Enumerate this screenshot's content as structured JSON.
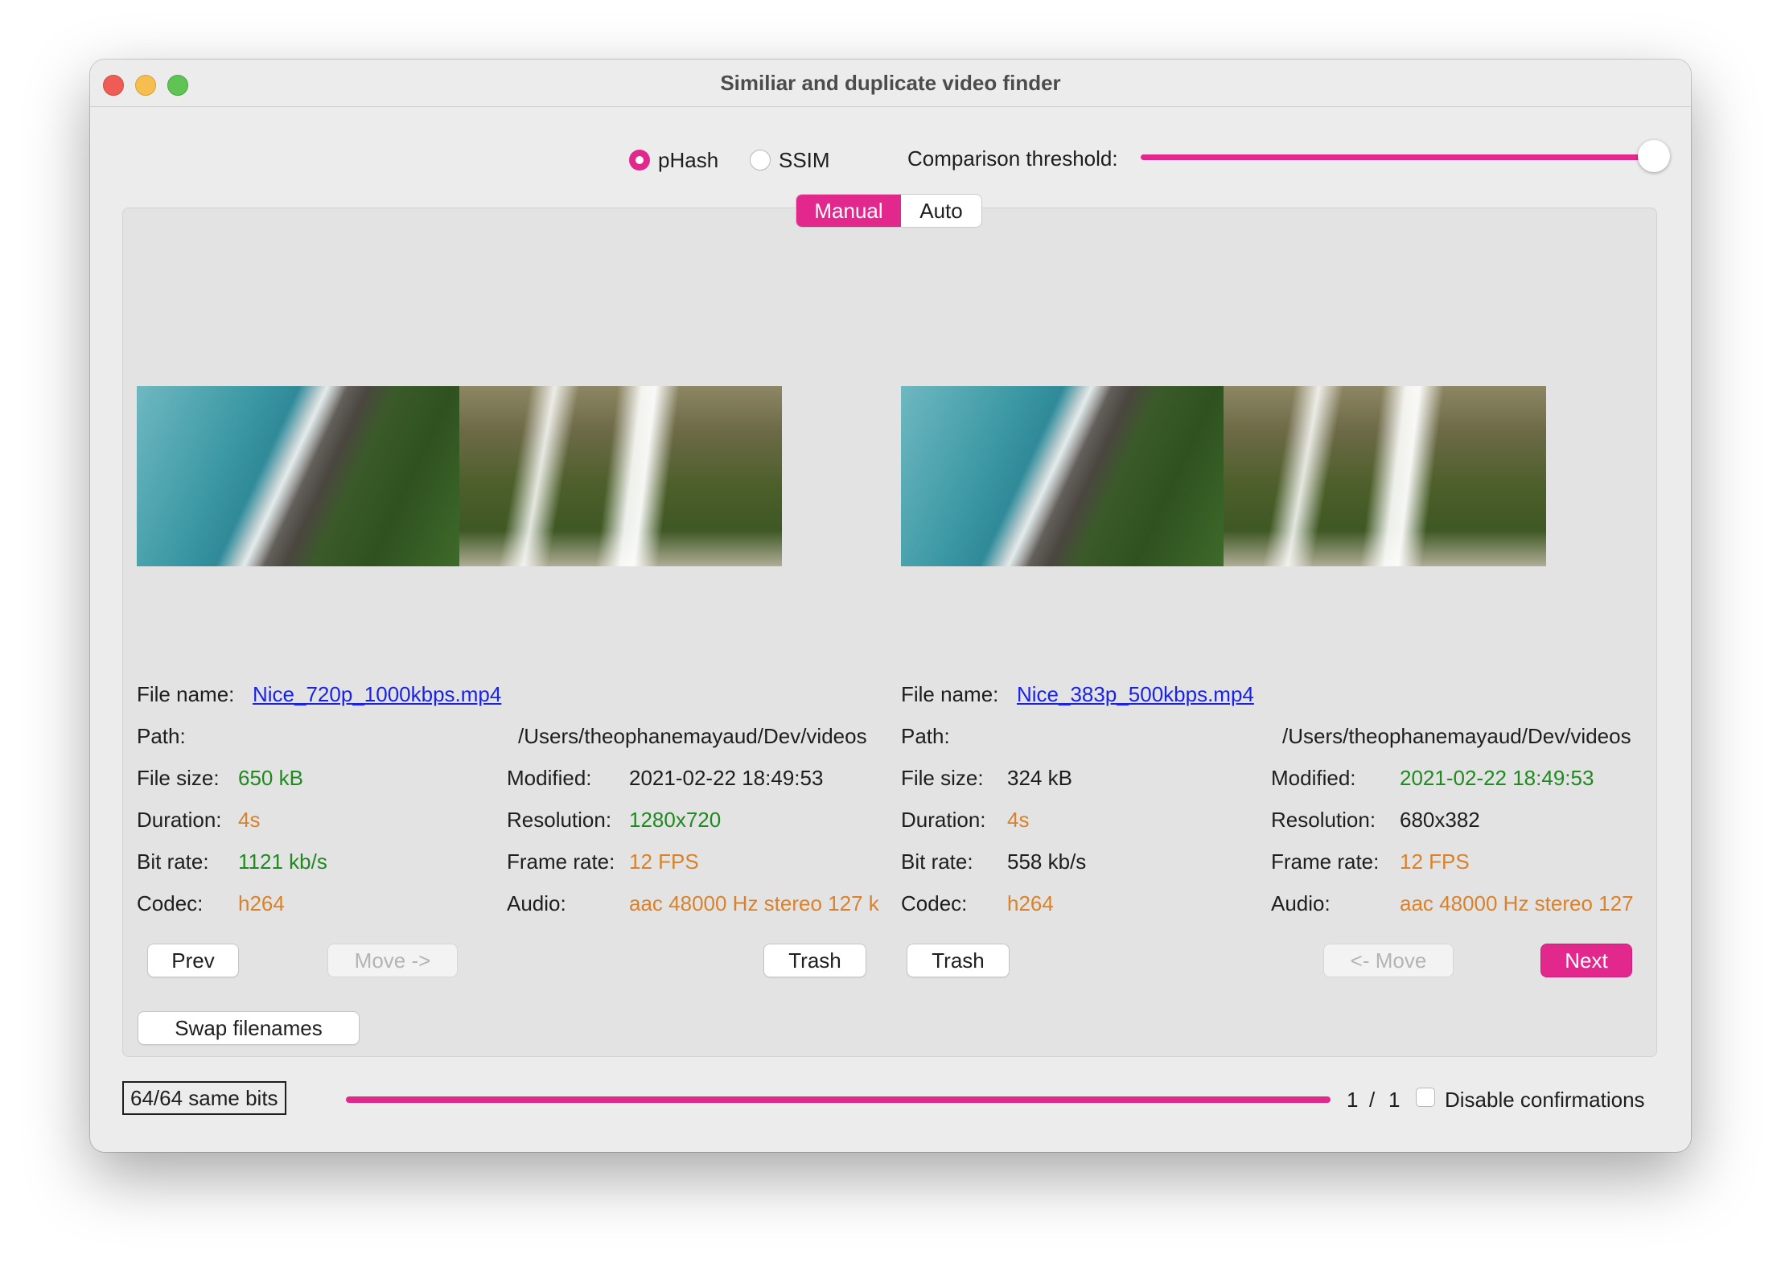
{
  "window": {
    "title": "Similiar and duplicate video finder"
  },
  "algorithm": {
    "options": [
      "pHash",
      "SSIM"
    ],
    "selected": "pHash"
  },
  "threshold": {
    "label": "Comparison threshold:",
    "value": 1.0
  },
  "mode_tabs": {
    "items": [
      "Manual",
      "Auto"
    ],
    "active": "Manual"
  },
  "left": {
    "file_name_label": "File name:",
    "file_name": "Nice_720p_1000kbps.mp4",
    "path_label": "Path:",
    "path": "/Users/theophanemayaud/Dev/videos",
    "file_size_label": "File size:",
    "file_size": "650 kB",
    "modified_label": "Modified:",
    "modified": "2021-02-22 18:49:53",
    "duration_label": "Duration:",
    "duration": "4s",
    "resolution_label": "Resolution:",
    "resolution": "1280x720",
    "bit_rate_label": "Bit rate:",
    "bit_rate": "1121 kb/s",
    "frame_rate_label": "Frame rate:",
    "frame_rate": "12 FPS",
    "codec_label": "Codec:",
    "codec": "h264",
    "audio_label": "Audio:",
    "audio": "aac 48000 Hz stereo 127 k"
  },
  "right": {
    "file_name_label": "File name:",
    "file_name": "Nice_383p_500kbps.mp4",
    "path_label": "Path:",
    "path": "/Users/theophanemayaud/Dev/videos",
    "file_size_label": "File size:",
    "file_size": "324 kB",
    "modified_label": "Modified:",
    "modified": "2021-02-22 18:49:53",
    "duration_label": "Duration:",
    "duration": "4s",
    "resolution_label": "Resolution:",
    "resolution": "680x382",
    "bit_rate_label": "Bit rate:",
    "bit_rate": "558 kb/s",
    "frame_rate_label": "Frame rate:",
    "frame_rate": "12 FPS",
    "codec_label": "Codec:",
    "codec": "h264",
    "audio_label": "Audio:",
    "audio": "aac 48000 Hz stereo 127"
  },
  "buttons": {
    "prev": "Prev",
    "move_right": "Move ->",
    "trash_left": "Trash",
    "trash_right": "Trash",
    "move_left": "<- Move",
    "next": "Next",
    "swap": "Swap filenames"
  },
  "footer": {
    "bits": "64/64 same bits",
    "progress": 1.0,
    "current": "1",
    "separator": "/",
    "total": "1",
    "disable_label": "Disable confirmations",
    "disable_checked": false
  },
  "colors": {
    "accent": "#e3288d",
    "link": "#1a22e6",
    "better": "#1f8a1f",
    "equal": "#d9822b"
  }
}
